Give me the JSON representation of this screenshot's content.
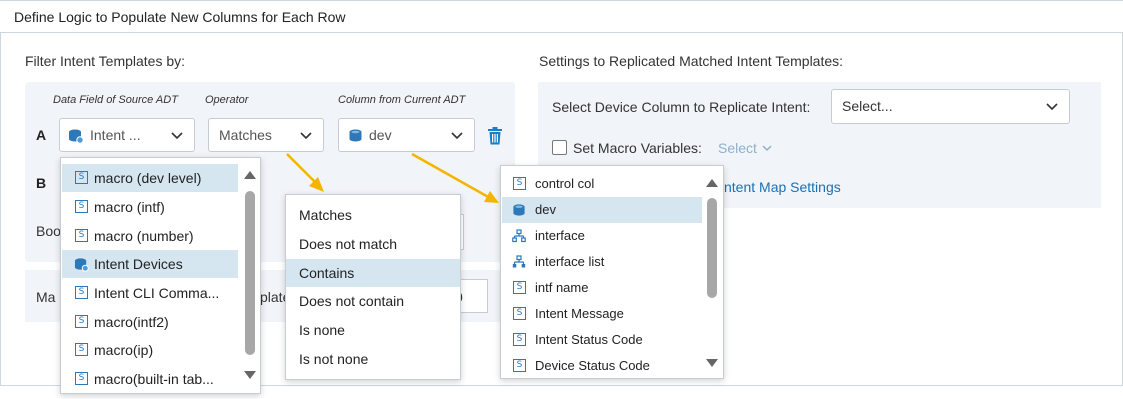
{
  "window": {
    "title": "Define Logic to Populate New Columns for Each Row"
  },
  "filter": {
    "label": "Filter Intent Templates by:",
    "col_heads": [
      "Data Field of Source ADT",
      "Operator",
      "Column from Current ADT"
    ],
    "row_a": {
      "letter": "A",
      "field": "Intent ...",
      "operator": "Matches",
      "column": "dev"
    },
    "row_b": {
      "letter": "B"
    },
    "partial_label_1": "Boo",
    "partial_label_2": "Ma",
    "partial_label_3": "plate",
    "partial_value": "0"
  },
  "settings": {
    "label": "Settings to Replicated Matched Intent Templates:",
    "device_col_label": "Select Device Column to Replicate Intent:",
    "device_col_value": "Select...",
    "macro_label": "Set Macro Variables:",
    "macro_select": "Select",
    "intent_map_link": "ntent Map Settings"
  },
  "dropdown_fields": {
    "items": [
      {
        "label": "macro (dev level)",
        "icon": "string-icon",
        "selected": true
      },
      {
        "label": "macro (intf)",
        "icon": "string-icon",
        "selected": false
      },
      {
        "label": "macro (number)",
        "icon": "string-icon",
        "selected": false
      },
      {
        "label": "Intent Devices",
        "icon": "device-icon",
        "selected": true
      },
      {
        "label": "Intent CLI Comma...",
        "icon": "string-icon",
        "selected": false
      },
      {
        "label": "macro(intf2)",
        "icon": "string-icon",
        "selected": false
      },
      {
        "label": "macro(ip)",
        "icon": "string-icon",
        "selected": false
      },
      {
        "label": "macro(built-in tab...",
        "icon": "string-icon",
        "selected": false
      }
    ]
  },
  "dropdown_operator": {
    "items": [
      {
        "label": "Matches",
        "selected": false
      },
      {
        "label": "Does not match",
        "selected": false
      },
      {
        "label": "Contains",
        "selected": true
      },
      {
        "label": "Does not contain",
        "selected": false
      },
      {
        "label": "Is none",
        "selected": false
      },
      {
        "label": "Is not none",
        "selected": false
      }
    ]
  },
  "dropdown_columns": {
    "items": [
      {
        "label": "control col",
        "icon": "string-icon",
        "selected": false
      },
      {
        "label": "dev",
        "icon": "device-icon",
        "selected": true
      },
      {
        "label": "interface",
        "icon": "interface-icon",
        "selected": false
      },
      {
        "label": "interface list",
        "icon": "interface-list-icon",
        "selected": false
      },
      {
        "label": "intf name",
        "icon": "string-icon",
        "selected": false
      },
      {
        "label": "Intent Message",
        "icon": "string-icon",
        "selected": false
      },
      {
        "label": "Intent Status Code",
        "icon": "string-icon",
        "selected": false
      },
      {
        "label": "Device Status Code",
        "icon": "string-icon",
        "selected": false
      }
    ]
  },
  "colors": {
    "accent": "#1c6fb4",
    "selection": "#d6e6f0",
    "arrow": "#f5b400",
    "panel": "#f1f4f8"
  }
}
